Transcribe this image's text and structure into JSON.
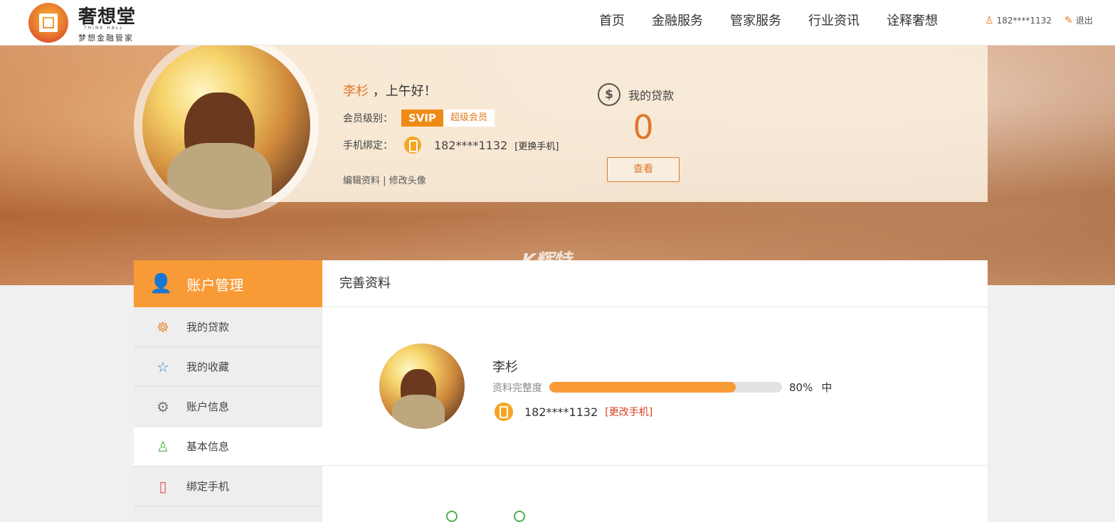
{
  "header": {
    "logo": {
      "cn": "奢想堂",
      "en": "THINK HALL",
      "slogan": "梦想金融管家"
    },
    "nav": [
      "首页",
      "金融服务",
      "管家服务",
      "行业资讯",
      "诠释奢想"
    ],
    "user_phone": "182****1132",
    "logout": "退出"
  },
  "profile": {
    "name": "李杉",
    "greeting": "，上午好！",
    "member_label": "会员级别：",
    "svip": "SVIP",
    "member_tag": "超级会员",
    "phone_label": "手机绑定：",
    "phone": "182****1132",
    "change_phone": "[更换手机]",
    "edit_profile": "编辑资料",
    "sep": "|",
    "change_avatar": "修改头像"
  },
  "loan": {
    "title": "我的贷款",
    "value": "0",
    "view": "查看"
  },
  "watermark": "K辉特",
  "sidebar": {
    "title": "账户管理",
    "items": [
      {
        "label": "我的贷款",
        "icon": "money-bag-icon"
      },
      {
        "label": "我的收藏",
        "icon": "star-icon"
      },
      {
        "label": "账户信息",
        "icon": "user-gear-icon"
      },
      {
        "label": "基本信息",
        "icon": "user-edit-icon"
      },
      {
        "label": "绑定手机",
        "icon": "phone-icon"
      }
    ]
  },
  "main": {
    "title": "完善资料",
    "name": "李杉",
    "completeness_label": "资料完整度",
    "completeness": 0.8,
    "completeness_text": "80%",
    "level": "中",
    "phone": "182****1132",
    "change_phone": "[更改手机]"
  },
  "colors": {
    "accent": "#f89a36",
    "accent_text": "#e0772b",
    "link_red": "#d9401f"
  }
}
